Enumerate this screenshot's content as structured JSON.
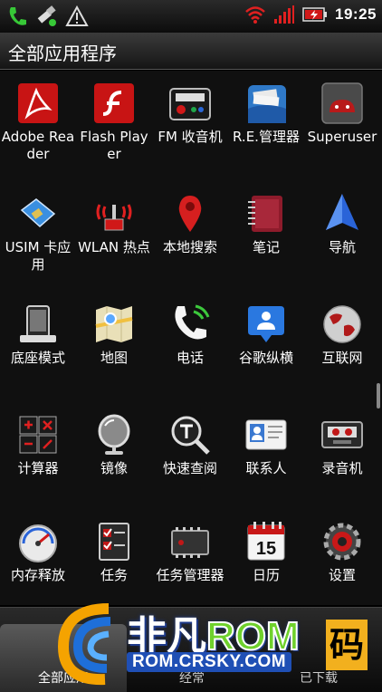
{
  "status_bar": {
    "time": "19:25",
    "icons": [
      "phone-signal-icon",
      "usb-debug-icon",
      "warning-icon",
      "wifi-icon",
      "signal-bars-icon",
      "battery-charging-icon"
    ]
  },
  "header": {
    "title": "全部应用程序"
  },
  "apps": [
    {
      "label": "Adobe Reader",
      "icon": "adobe-reader-icon"
    },
    {
      "label": "Flash Player",
      "icon": "flash-player-icon"
    },
    {
      "label": "FM 收音机",
      "icon": "fm-radio-icon"
    },
    {
      "label": "R.E.管理器",
      "icon": "re-manager-icon"
    },
    {
      "label": "Superuser",
      "icon": "superuser-icon"
    },
    {
      "label": "USIM 卡应用",
      "icon": "sim-card-icon"
    },
    {
      "label": "WLAN 热点",
      "icon": "wifi-hotspot-icon"
    },
    {
      "label": "本地搜索",
      "icon": "map-pin-icon"
    },
    {
      "label": "笔记",
      "icon": "notebook-icon"
    },
    {
      "label": "导航",
      "icon": "navigation-arrow-icon"
    },
    {
      "label": "底座模式",
      "icon": "dock-mode-icon"
    },
    {
      "label": "地图",
      "icon": "maps-icon"
    },
    {
      "label": "电话",
      "icon": "phone-icon"
    },
    {
      "label": "谷歌纵横",
      "icon": "latitude-icon"
    },
    {
      "label": "互联网",
      "icon": "globe-icon"
    },
    {
      "label": "计算器",
      "icon": "calculator-icon"
    },
    {
      "label": "镜像",
      "icon": "mirror-icon"
    },
    {
      "label": "快速查阅",
      "icon": "quick-lookup-icon"
    },
    {
      "label": "联系人",
      "icon": "contacts-icon"
    },
    {
      "label": "录音机",
      "icon": "voice-recorder-icon"
    },
    {
      "label": "内存释放",
      "icon": "memory-gauge-icon"
    },
    {
      "label": "任务",
      "icon": "tasks-icon"
    },
    {
      "label": "任务管理器",
      "icon": "task-manager-icon"
    },
    {
      "label": "日历",
      "icon": "calendar-icon"
    },
    {
      "label": "设置",
      "icon": "settings-gear-icon"
    }
  ],
  "calendar_day": "15",
  "tabs": [
    {
      "label": "全部应用"
    },
    {
      "label": "经常"
    },
    {
      "label": "已下载"
    }
  ],
  "watermark": {
    "brand": "非凡",
    "rom": "ROM",
    "url": "ROM.CRSKY.COM",
    "badge": "码"
  }
}
